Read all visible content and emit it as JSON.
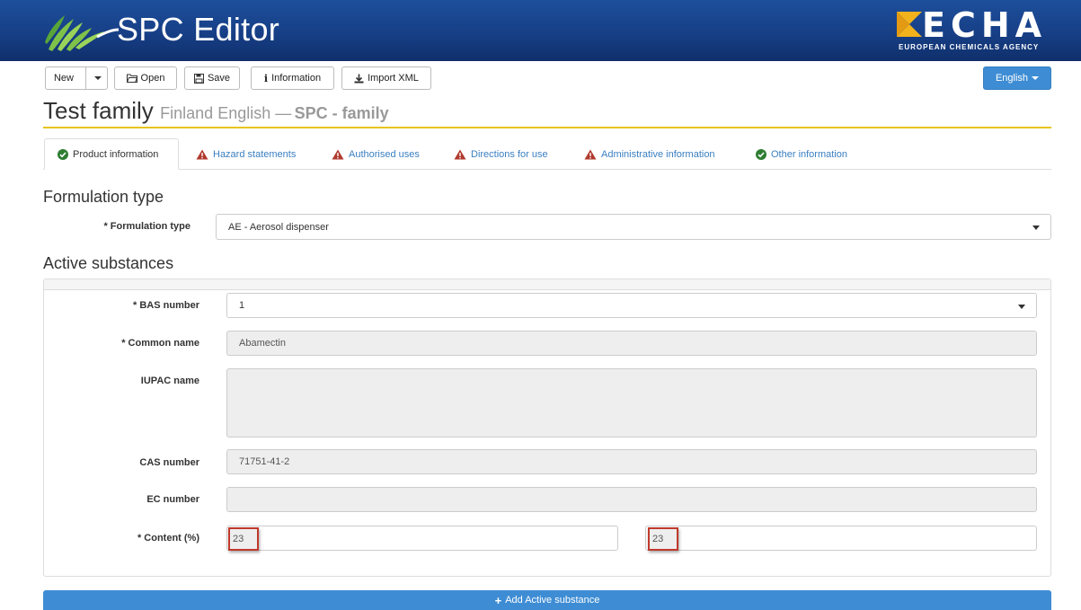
{
  "header": {
    "app_title": "SPC Editor",
    "agency_short": "ECHA",
    "agency_full": "EUROPEAN CHEMICALS AGENCY"
  },
  "toolbar": {
    "new_label": "New",
    "open_label": "Open",
    "save_label": "Save",
    "information_label": "Information",
    "import_label": "Import XML",
    "language_label": "English"
  },
  "page": {
    "title": "Test family",
    "subtitle": "Finland English —",
    "subtitle_bold": "SPC - family"
  },
  "tabs": [
    {
      "label": "Product information",
      "status": "ok"
    },
    {
      "label": "Hazard statements",
      "status": "warning"
    },
    {
      "label": "Authorised uses",
      "status": "warning"
    },
    {
      "label": "Directions for use",
      "status": "warning"
    },
    {
      "label": "Administrative information",
      "status": "warning"
    },
    {
      "label": "Other information",
      "status": "ok"
    }
  ],
  "formulation": {
    "heading": "Formulation type",
    "label": "* Formulation type",
    "value": "AE - Aerosol dispenser"
  },
  "active_substances": {
    "heading": "Active substances",
    "bas_label": "* BAS number",
    "bas_value": "1",
    "common_label": "* Common name",
    "common_value": "Abamectin",
    "iupac_label": "IUPAC name",
    "iupac_value": "",
    "cas_label": "CAS number",
    "cas_value": "71751-41-2",
    "ec_label": "EC number",
    "ec_value": "",
    "content_label": "* Content (%)",
    "content_min": "23",
    "content_max": "23"
  },
  "add_button_label": "Add Active substance",
  "colors": {
    "header_blue": "#173f86",
    "accent_yellow": "#e8c41c",
    "primary_blue": "#3e8dd4",
    "ok_green": "#2e7d32",
    "warning_red": "#b03a2e",
    "highlight_red": "#c0392b"
  },
  "icons": {
    "ok": "check-circle-icon",
    "warning": "warning-triangle-icon"
  }
}
